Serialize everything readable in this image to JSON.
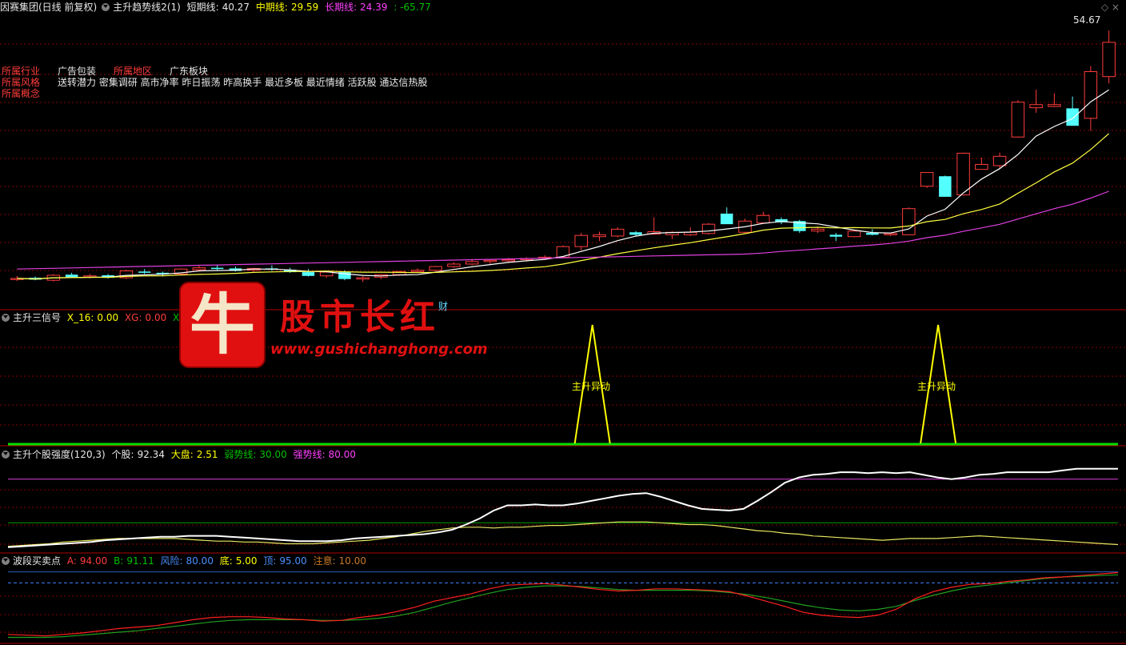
{
  "header": {
    "stock_name": "因赛集团(日线 前复权)",
    "indicator_name": "主升趋势线2(1)",
    "short_label": "短期线:",
    "short_value": "40.27",
    "mid_label": "中期线:",
    "mid_value": "29.59",
    "long_label": "长期线:",
    "long_value": "24.39",
    "extra_value": ": -65.77"
  },
  "info": {
    "industry_label": "所属行业",
    "industry_value": "广告包装",
    "region_label": "所属地区",
    "region_value": "广东板块",
    "style_label": "所属风格",
    "style_value": "送转潜力 密集调研 高市净率 昨日振荡 昨高换手 最近多板 最近情绪 活跃股 通达信热股",
    "concept_label": "所属概念"
  },
  "price_label": "54.67",
  "fin_marker": "财",
  "panel2": {
    "title": "主升三信号",
    "x16_label": "X_16:",
    "x16_value": "0.00",
    "xg_label": "XG:",
    "xg_value": "0.00",
    "xg1_label": "XG1:",
    "signal_text": "主升异动"
  },
  "panel3": {
    "title": "主升个股强度(120,3)",
    "stock_label": "个股:",
    "stock_value": "92.34",
    "market_label": "大盘:",
    "market_value": "2.51",
    "weak_label": "弱势线:",
    "weak_value": "30.00",
    "strong_label": "强势线:",
    "strong_value": "80.00"
  },
  "panel4": {
    "title": "波段买卖点",
    "a_label": "A:",
    "a_value": "94.00",
    "b_label": "B:",
    "b_value": "91.11",
    "risk_label": "风险:",
    "risk_value": "80.00",
    "bottom_label": "底:",
    "bottom_value": "5.00",
    "top_label": "顶:",
    "top_value": "95.00",
    "note_label": "注意:",
    "note_value": "10.00"
  },
  "watermark": {
    "logo_char": "牛",
    "title": "股市长红",
    "url": "www.gushichanghong.com"
  },
  "colors": {
    "up": "#ff3c3c",
    "down": "#54ffff",
    "short": "#ffffff",
    "mid": "#ffff40",
    "long": "#e040e0",
    "grid": "#8b0000"
  },
  "chart_data": [
    {
      "type": "candlestick",
      "ylim": [
        10,
        56
      ],
      "candles": [
        {
          "o": 14.8,
          "h": 15.3,
          "l": 14.5,
          "c": 14.9
        },
        {
          "o": 15.0,
          "h": 15.2,
          "l": 14.6,
          "c": 14.7
        },
        {
          "o": 14.6,
          "h": 15.6,
          "l": 14.4,
          "c": 15.4
        },
        {
          "o": 15.5,
          "h": 15.8,
          "l": 15.0,
          "c": 15.1
        },
        {
          "o": 15.2,
          "h": 15.6,
          "l": 14.9,
          "c": 15.3
        },
        {
          "o": 15.4,
          "h": 15.6,
          "l": 14.9,
          "c": 15.0
        },
        {
          "o": 15.0,
          "h": 16.3,
          "l": 14.8,
          "c": 16.1
        },
        {
          "o": 16.0,
          "h": 16.4,
          "l": 15.6,
          "c": 15.8
        },
        {
          "o": 15.8,
          "h": 16.0,
          "l": 15.2,
          "c": 15.6
        },
        {
          "o": 15.6,
          "h": 16.5,
          "l": 15.4,
          "c": 16.4
        },
        {
          "o": 16.3,
          "h": 16.9,
          "l": 16.0,
          "c": 16.6
        },
        {
          "o": 16.6,
          "h": 17.1,
          "l": 16.2,
          "c": 16.4
        },
        {
          "o": 16.5,
          "h": 16.8,
          "l": 16.0,
          "c": 16.1
        },
        {
          "o": 16.2,
          "h": 16.6,
          "l": 15.8,
          "c": 16.5
        },
        {
          "o": 16.5,
          "h": 17.0,
          "l": 16.1,
          "c": 16.3
        },
        {
          "o": 16.3,
          "h": 16.6,
          "l": 15.8,
          "c": 15.9
        },
        {
          "o": 15.9,
          "h": 16.4,
          "l": 15.2,
          "c": 15.3
        },
        {
          "o": 15.3,
          "h": 16.0,
          "l": 15.0,
          "c": 15.9
        },
        {
          "o": 15.9,
          "h": 16.2,
          "l": 14.6,
          "c": 14.8
        },
        {
          "o": 14.8,
          "h": 15.3,
          "l": 14.3,
          "c": 15.0
        },
        {
          "o": 15.1,
          "h": 15.6,
          "l": 14.8,
          "c": 15.5
        },
        {
          "o": 15.5,
          "h": 16.1,
          "l": 15.3,
          "c": 16.0
        },
        {
          "o": 16.0,
          "h": 16.5,
          "l": 15.8,
          "c": 16.2
        },
        {
          "o": 16.2,
          "h": 16.9,
          "l": 16.0,
          "c": 16.8
        },
        {
          "o": 16.8,
          "h": 17.5,
          "l": 16.6,
          "c": 17.2
        },
        {
          "o": 17.2,
          "h": 18.0,
          "l": 17.0,
          "c": 17.6
        },
        {
          "o": 17.6,
          "h": 17.9,
          "l": 17.2,
          "c": 17.8
        },
        {
          "o": 17.8,
          "h": 18.2,
          "l": 17.5,
          "c": 17.9
        },
        {
          "o": 17.9,
          "h": 18.3,
          "l": 17.6,
          "c": 18.1
        },
        {
          "o": 18.1,
          "h": 18.6,
          "l": 17.9,
          "c": 18.3
        },
        {
          "o": 18.3,
          "h": 20.2,
          "l": 18.1,
          "c": 20.0
        },
        {
          "o": 20.0,
          "h": 22.2,
          "l": 19.4,
          "c": 21.8
        },
        {
          "o": 21.6,
          "h": 22.4,
          "l": 20.9,
          "c": 21.9
        },
        {
          "o": 21.7,
          "h": 23.1,
          "l": 21.5,
          "c": 22.8
        },
        {
          "o": 22.3,
          "h": 22.5,
          "l": 21.7,
          "c": 21.9
        },
        {
          "o": 22.0,
          "h": 24.7,
          "l": 21.9,
          "c": 22.4
        },
        {
          "o": 21.9,
          "h": 22.5,
          "l": 21.2,
          "c": 22.3
        },
        {
          "o": 21.9,
          "h": 23.1,
          "l": 21.7,
          "c": 22.3
        },
        {
          "o": 22.1,
          "h": 23.8,
          "l": 21.9,
          "c": 23.6
        },
        {
          "o": 25.3,
          "h": 26.3,
          "l": 23.8,
          "c": 23.6
        },
        {
          "o": 22.3,
          "h": 24.5,
          "l": 22.2,
          "c": 24.1
        },
        {
          "o": 23.8,
          "h": 25.6,
          "l": 23.8,
          "c": 25.0
        },
        {
          "o": 24.4,
          "h": 24.7,
          "l": 23.6,
          "c": 23.9
        },
        {
          "o": 24.1,
          "h": 24.3,
          "l": 22.2,
          "c": 22.5
        },
        {
          "o": 22.5,
          "h": 23.1,
          "l": 22.2,
          "c": 22.8
        },
        {
          "o": 21.9,
          "h": 22.2,
          "l": 20.9,
          "c": 21.6
        },
        {
          "o": 21.6,
          "h": 22.6,
          "l": 21.5,
          "c": 22.5
        },
        {
          "o": 22.2,
          "h": 22.8,
          "l": 21.8,
          "c": 21.9
        },
        {
          "o": 21.9,
          "h": 22.2,
          "l": 21.7,
          "c": 22.1
        },
        {
          "o": 21.9,
          "h": 26.3,
          "l": 21.9,
          "c": 26.1
        },
        {
          "o": 29.7,
          "h": 31.9,
          "l": 29.4,
          "c": 31.9
        },
        {
          "o": 31.3,
          "h": 31.4,
          "l": 28.0,
          "c": 28.0
        },
        {
          "o": 28.3,
          "h": 35.1,
          "l": 28.2,
          "c": 35.0
        },
        {
          "o": 32.4,
          "h": 34.3,
          "l": 32.4,
          "c": 33.2
        },
        {
          "o": 33.0,
          "h": 35.1,
          "l": 32.6,
          "c": 34.5
        },
        {
          "o": 37.6,
          "h": 43.5,
          "l": 37.5,
          "c": 43.2
        },
        {
          "o": 42.3,
          "h": 45.2,
          "l": 41.5,
          "c": 42.8
        },
        {
          "o": 42.5,
          "h": 44.6,
          "l": 42.4,
          "c": 42.8
        },
        {
          "o": 42.2,
          "h": 44.1,
          "l": 39.5,
          "c": 39.4
        },
        {
          "o": 40.6,
          "h": 49.0,
          "l": 38.6,
          "c": 48.1
        },
        {
          "o": 47.3,
          "h": 54.7,
          "l": 46.2,
          "c": 52.8
        }
      ]
    },
    {
      "type": "line",
      "title": "主升三信号",
      "series": [
        {
          "name": "X_16",
          "values": [
            0,
            0,
            0,
            0,
            0,
            0,
            0,
            0,
            0,
            0,
            0,
            0,
            0,
            0,
            0,
            0,
            0,
            0,
            0,
            0,
            0,
            0,
            0,
            0,
            0,
            0,
            0,
            0,
            0,
            0,
            0,
            1,
            0,
            0,
            0,
            0,
            0,
            0,
            0,
            0,
            0,
            0,
            0,
            0,
            0,
            0,
            0,
            0,
            0,
            0,
            1,
            0,
            0,
            0,
            0,
            0,
            0,
            0,
            0,
            0,
            0
          ]
        }
      ],
      "ylim": [
        0,
        1
      ]
    },
    {
      "type": "line",
      "title": "主升个股强度(120,3)",
      "ylim": [
        0,
        100
      ],
      "hlines": [
        30,
        80
      ],
      "series": [
        {
          "name": "个股",
          "values": [
            2,
            3,
            4,
            5,
            6,
            7,
            8,
            10,
            11,
            12,
            13,
            14,
            14,
            15,
            15,
            15,
            14,
            13,
            12,
            11,
            10,
            9,
            9,
            9,
            10,
            12,
            13,
            14,
            15,
            16,
            17,
            19,
            22,
            28,
            35,
            44,
            50,
            50,
            51,
            50,
            50,
            52,
            55,
            58,
            61,
            63,
            64,
            60,
            55,
            50,
            46,
            45,
            44,
            46,
            55,
            65,
            76,
            82,
            85,
            86,
            88,
            88,
            87,
            88,
            87,
            88,
            85,
            82,
            80,
            82,
            85,
            86,
            88,
            88,
            88,
            88,
            90,
            92,
            92,
            92,
            92
          ]
        },
        {
          "name": "大盘",
          "values": [
            3,
            4,
            5,
            6,
            8,
            9,
            10,
            11,
            12,
            12,
            12,
            12,
            12,
            11,
            10,
            9,
            9,
            8,
            8,
            7,
            6,
            6,
            6,
            7,
            8,
            9,
            10,
            12,
            14,
            17,
            20,
            22,
            24,
            25,
            25,
            24,
            25,
            25,
            26,
            27,
            27,
            28,
            29,
            30,
            31,
            31,
            31,
            30,
            29,
            28,
            28,
            27,
            25,
            23,
            21,
            20,
            18,
            17,
            15,
            14,
            13,
            12,
            11,
            10,
            11,
            12,
            12,
            12,
            13,
            14,
            15,
            14,
            13,
            12,
            11,
            10,
            9,
            8,
            7,
            6,
            5
          ]
        }
      ]
    },
    {
      "type": "line",
      "title": "波段买卖点",
      "ylim": [
        0,
        100
      ],
      "hlines": [
        80,
        95,
        5
      ],
      "series": [
        {
          "name": "A",
          "values": [
            10,
            9,
            8,
            10,
            12,
            15,
            18,
            20,
            22,
            26,
            30,
            33,
            34,
            34,
            33,
            31,
            30,
            28,
            29,
            33,
            36,
            41,
            47,
            55,
            60,
            65,
            72,
            77,
            78,
            79,
            77,
            74,
            71,
            69,
            70,
            72,
            72,
            71,
            70,
            68,
            62,
            55,
            48,
            40,
            36,
            34,
            33,
            36,
            44,
            58,
            68,
            74,
            78,
            79,
            82,
            84,
            87,
            88,
            90,
            92,
            94
          ]
        },
        {
          "name": "B",
          "values": [
            6,
            6,
            6,
            7,
            9,
            11,
            13,
            15,
            18,
            21,
            24,
            27,
            29,
            30,
            30,
            30,
            30,
            29,
            29,
            30,
            32,
            35,
            40,
            47,
            54,
            60,
            66,
            71,
            74,
            76,
            76,
            75,
            73,
            71,
            70,
            70,
            70,
            70,
            69,
            67,
            64,
            60,
            55,
            50,
            46,
            43,
            42,
            44,
            48,
            56,
            63,
            69,
            74,
            77,
            80,
            83,
            86,
            88,
            89,
            90,
            91
          ]
        }
      ]
    }
  ]
}
